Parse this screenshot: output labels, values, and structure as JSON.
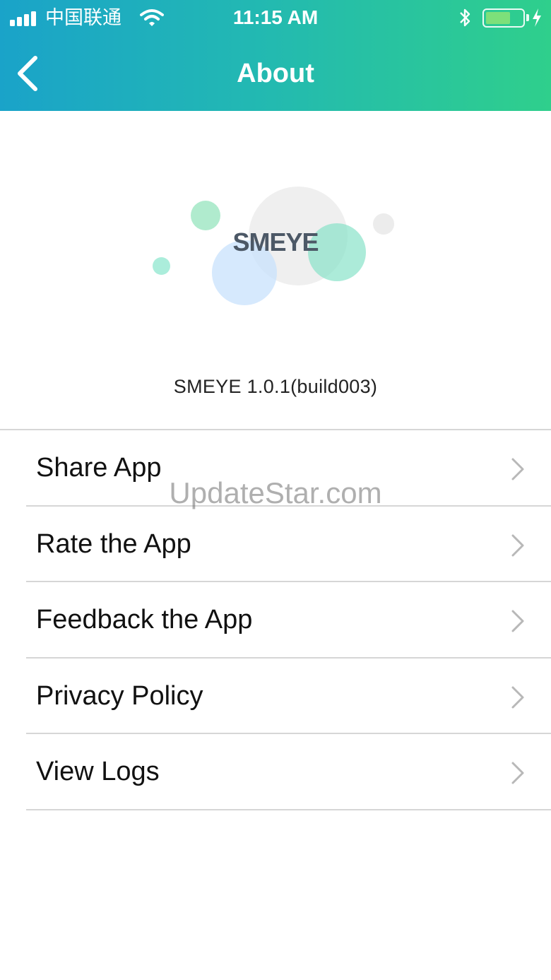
{
  "status_bar": {
    "carrier": "中国联通",
    "time": "11:15 AM"
  },
  "nav": {
    "title": "About",
    "back_icon": "chevron-left-icon"
  },
  "app": {
    "logo_text": "SMEYE",
    "version": "SMEYE  1.0.1(build003)"
  },
  "menu": {
    "items": [
      {
        "label": "Share App"
      },
      {
        "label": "Rate the App"
      },
      {
        "label": "Feedback the App"
      },
      {
        "label": "Privacy Policy"
      },
      {
        "label": "View Logs"
      }
    ],
    "chevron_icon": "chevron-right-icon"
  },
  "watermark": "UpdateStar.com",
  "colors": {
    "header_gradient_start": "#1aa3c9",
    "header_gradient_end": "#2fcf8c",
    "divider": "#d6d6d6",
    "logo_text": "#4c5866",
    "battery_fill": "#7de07a"
  }
}
